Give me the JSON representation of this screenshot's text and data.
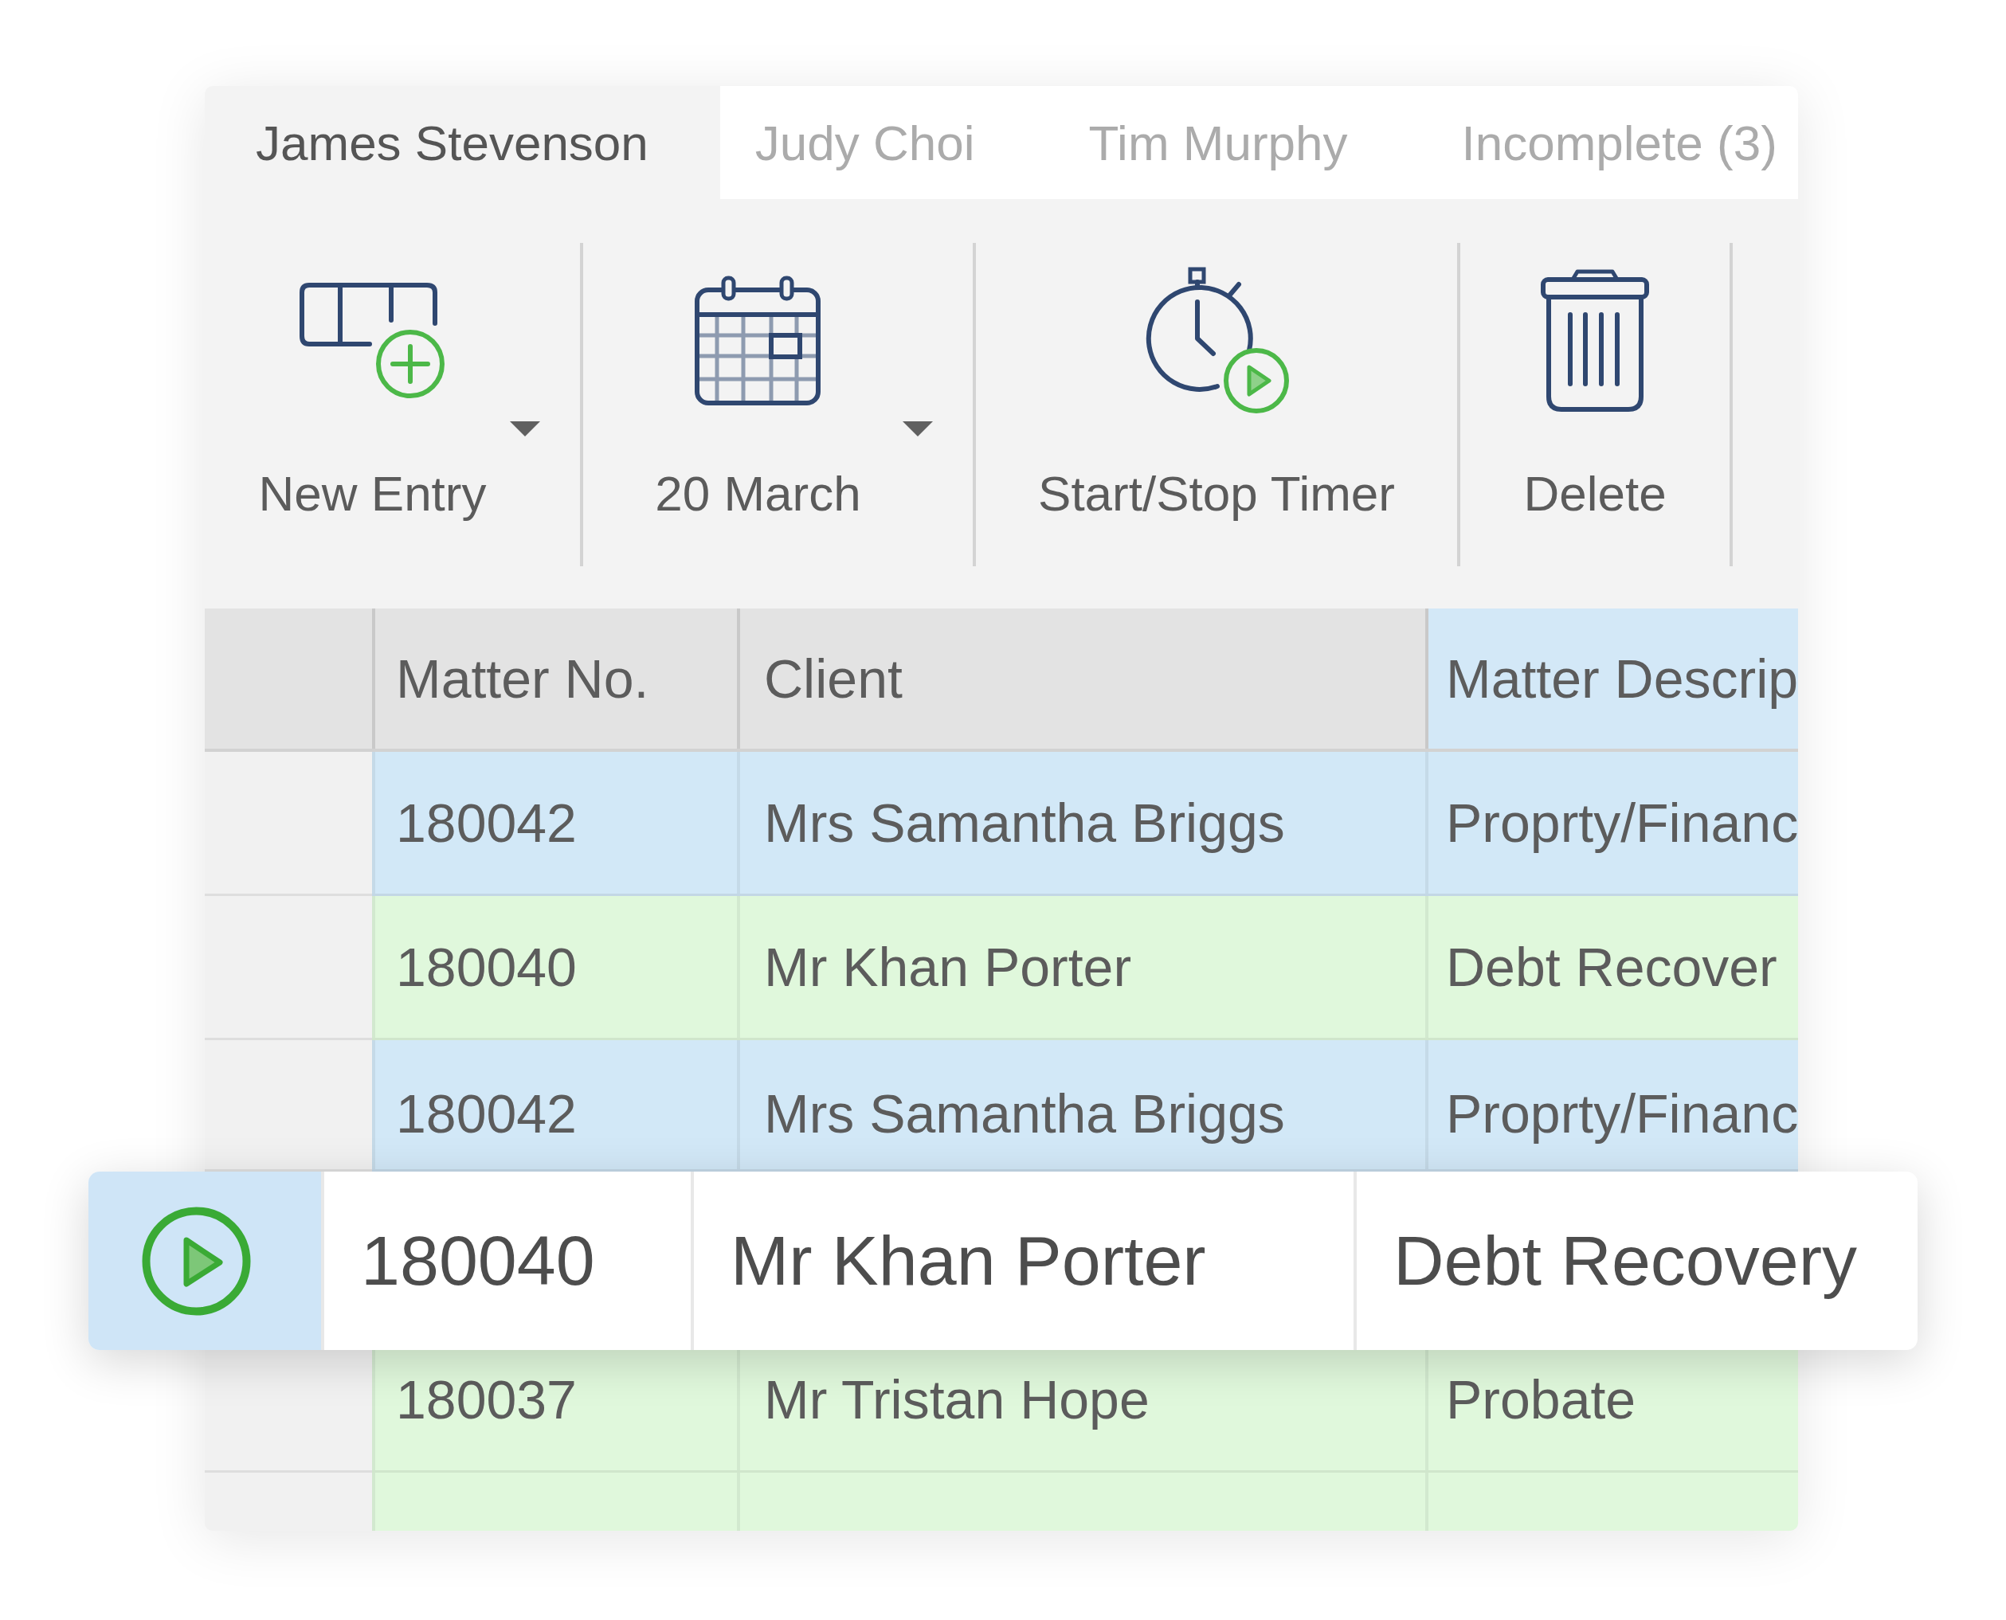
{
  "tabs": [
    {
      "label": "James Stevenson",
      "selected": true
    },
    {
      "label": "Judy Choi",
      "selected": false
    },
    {
      "label": "Tim Murphy",
      "selected": false
    },
    {
      "label": "Incomplete (3)",
      "selected": false
    }
  ],
  "toolbar": [
    {
      "kind": "add",
      "label": "New Entry",
      "dropdown": true
    },
    {
      "kind": "calendar",
      "label": "20 March",
      "dropdown": true
    },
    {
      "kind": "timer",
      "label": "Start/Stop Timer",
      "dropdown": false
    },
    {
      "kind": "delete",
      "label": "Delete",
      "dropdown": false
    }
  ],
  "table": {
    "columns": [
      {
        "label": "Matter No.",
        "selected": false
      },
      {
        "label": "Client",
        "selected": false
      },
      {
        "label": "Matter Descrip",
        "selected": true
      }
    ],
    "rows": [
      {
        "cells": [
          "180042",
          "Mrs Samantha Briggs",
          "Proprty/Financ"
        ],
        "color": "#d2e8f7",
        "lifted": false
      },
      {
        "cells": [
          "180040",
          "Mr Khan Porter",
          "Debt Recover"
        ],
        "color": "#e0f8dc",
        "lifted": false
      },
      {
        "cells": [
          "180042",
          "Mrs Samantha Briggs",
          "Proprty/Financ"
        ],
        "color": "#d2e8f7",
        "lifted": false
      },
      {
        "cells": [
          "180040",
          "Mr Khan Porter",
          "Debt Recovery"
        ],
        "lifted": true
      },
      {
        "cells": [
          "180037",
          "Mr Tristan Hope",
          "Probate"
        ],
        "color": "#e0f8dc",
        "lifted": false
      },
      {
        "color": "#e0f8dc",
        "lifted": false
      }
    ]
  }
}
